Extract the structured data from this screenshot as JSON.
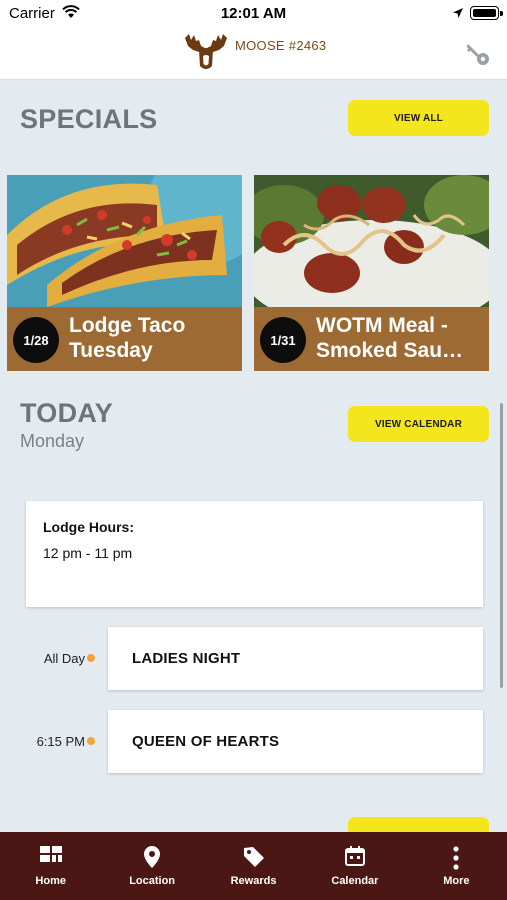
{
  "status_bar": {
    "carrier": "Carrier",
    "time": "12:01 AM"
  },
  "header": {
    "brand": "MOOSE #2463",
    "logo_icon": "moose-logo",
    "action_icon": "key-icon"
  },
  "specials": {
    "title": "SPECIALS",
    "view_all_label": "VIEW ALL",
    "items": [
      {
        "date": "1/28",
        "title": "Lodge Taco\nTuesday"
      },
      {
        "date": "1/31",
        "title": "WOTM Meal -\nSmoked Sau…"
      }
    ]
  },
  "today": {
    "title": "TODAY",
    "day": "Monday",
    "view_calendar_label": "VIEW CALENDAR",
    "hours_label": "Lodge Hours:",
    "hours_value": "12 pm - 11 pm",
    "events": [
      {
        "time": "All Day",
        "name": "LADIES NIGHT"
      },
      {
        "time": "6:15 PM",
        "name": "QUEEN OF HEARTS"
      }
    ]
  },
  "tabs": [
    {
      "label": "Home",
      "icon": "home-grid-icon"
    },
    {
      "label": "Location",
      "icon": "map-pin-icon"
    },
    {
      "label": "Rewards",
      "icon": "tag-icon"
    },
    {
      "label": "Calendar",
      "icon": "calendar-icon"
    },
    {
      "label": "More",
      "icon": "more-vertical-icon"
    }
  ],
  "colors": {
    "accent_yellow": "#f4e61c",
    "banner_brown": "#9d6a34",
    "tab_bar": "#4a1714",
    "event_dot": "#f4a23c"
  }
}
